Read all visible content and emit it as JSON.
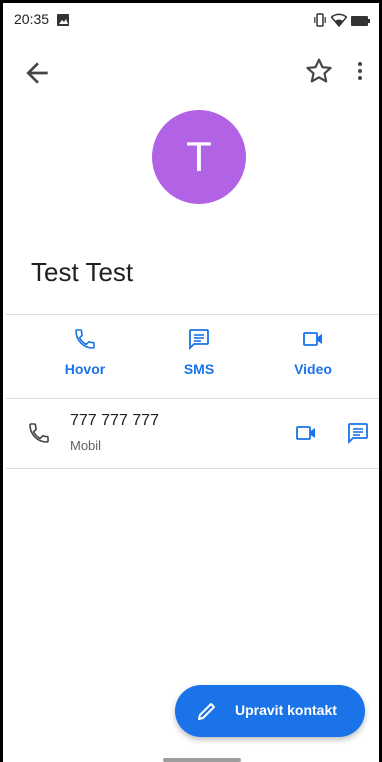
{
  "status": {
    "time": "20:35"
  },
  "contact": {
    "initial": "T",
    "name": "Test Test"
  },
  "actions": [
    {
      "label": "Hovor",
      "icon": "phone-icon"
    },
    {
      "label": "SMS",
      "icon": "message-icon"
    },
    {
      "label": "Video",
      "icon": "video-icon"
    }
  ],
  "phone": {
    "number": "777 777 777",
    "type": "Mobil"
  },
  "fab": {
    "label": "Upravit kontakt",
    "icon": "pencil-icon"
  },
  "colors": {
    "accent": "#1a73e8",
    "avatar": "#b162e5"
  }
}
